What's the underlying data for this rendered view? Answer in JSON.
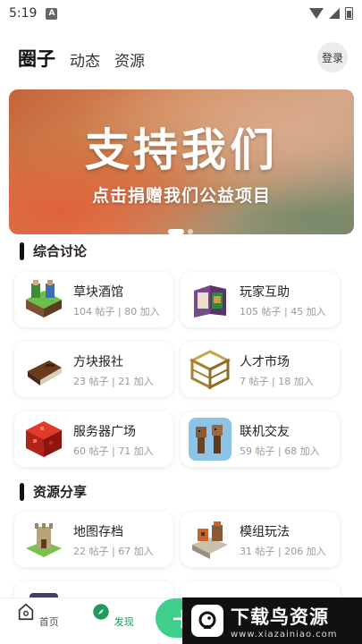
{
  "status": {
    "time": "5:19",
    "badge": "A"
  },
  "header": {
    "title": "圈子",
    "tabs": [
      "动态",
      "资源"
    ],
    "login_label": "登录"
  },
  "banner": {
    "title": "支持我们",
    "subtitle": "点击捐赠我们公益项目"
  },
  "sections": [
    {
      "title": "综合讨论",
      "cards": [
        {
          "name": "草块酒馆",
          "stats": "104 帖子 | 80 加入",
          "icon": "grass-tavern-icon"
        },
        {
          "name": "玩家互助",
          "stats": "105 帖子 | 45 加入",
          "icon": "book-icon"
        },
        {
          "name": "方块报社",
          "stats": "23 帖子 | 21 加入",
          "icon": "brown-book-icon"
        },
        {
          "name": "人才市场",
          "stats": "7 帖子 | 18 加入",
          "icon": "scaffold-icon"
        },
        {
          "name": "服务器广场",
          "stats": "60 帖子 | 71 加入",
          "icon": "redstone-block-icon"
        },
        {
          "name": "联机交友",
          "stats": "59 帖子 | 68 加入",
          "icon": "villagers-icon"
        }
      ]
    },
    {
      "title": "资源分享",
      "cards": [
        {
          "name": "地图存档",
          "stats": "22 帖子 | 67 加入",
          "icon": "castle-icon"
        },
        {
          "name": "模组玩法",
          "stats": "31 帖子 | 206 加入",
          "icon": "workshop-icon"
        }
      ]
    }
  ],
  "bottom_nav": {
    "home_label": "首页",
    "discover_label": "发现"
  },
  "watermark": {
    "title": "下载鸟资源",
    "url": "www.xiazainiao.com"
  },
  "colors": {
    "accent": "#1e9b5a",
    "fab": "#3ed08a"
  }
}
